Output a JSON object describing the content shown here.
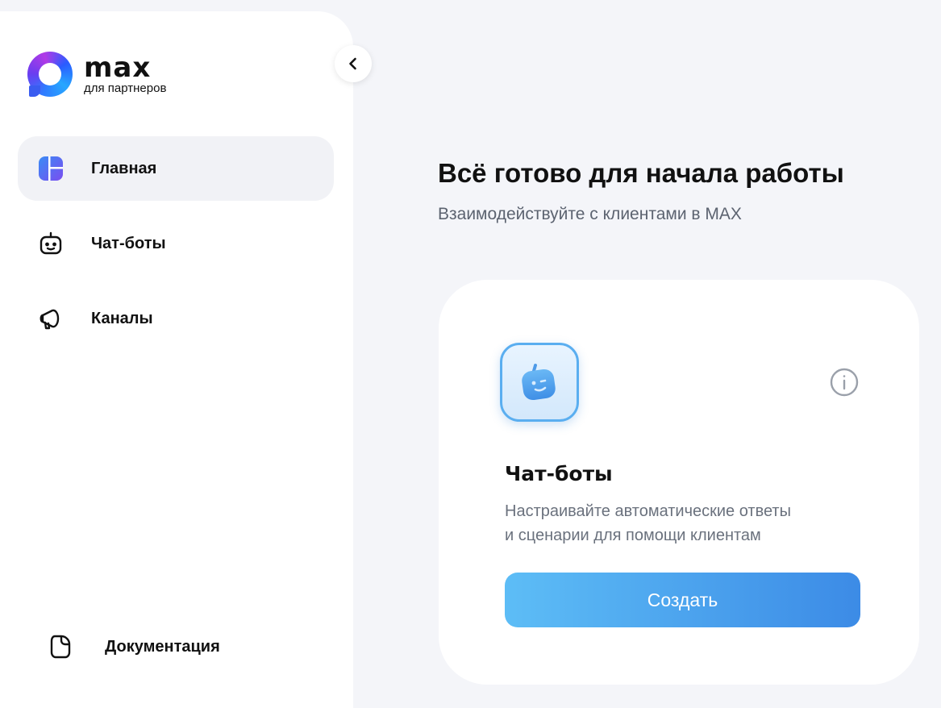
{
  "brand": {
    "name": "MAX",
    "subtitle": "для партнеров"
  },
  "sidebar": {
    "items": [
      {
        "label": "Главная",
        "icon": "dashboard-icon",
        "active": true
      },
      {
        "label": "Чат-боты",
        "icon": "bot-icon",
        "active": false
      },
      {
        "label": "Каналы",
        "icon": "megaphone-icon",
        "active": false
      }
    ],
    "documentation": {
      "label": "Документация",
      "icon": "document-icon"
    },
    "collapse_icon": "chevron-left-icon"
  },
  "main": {
    "title": "Всё готово для начала работы",
    "subtitle": "Взаимодействуйте с клиентами в MAX"
  },
  "card": {
    "title": "Чат-боты",
    "description_line1": "Настраивайте автоматические ответы",
    "description_line2": "и сценарии для помощи клиентам",
    "button_label": "Создать",
    "icon": "bot-tile-icon",
    "info_icon": "info-icon"
  },
  "colors": {
    "background": "#f4f5f9",
    "accent_start": "#5dbdf6",
    "accent_end": "#3c8be6",
    "active_item": "#f1f2f6"
  }
}
